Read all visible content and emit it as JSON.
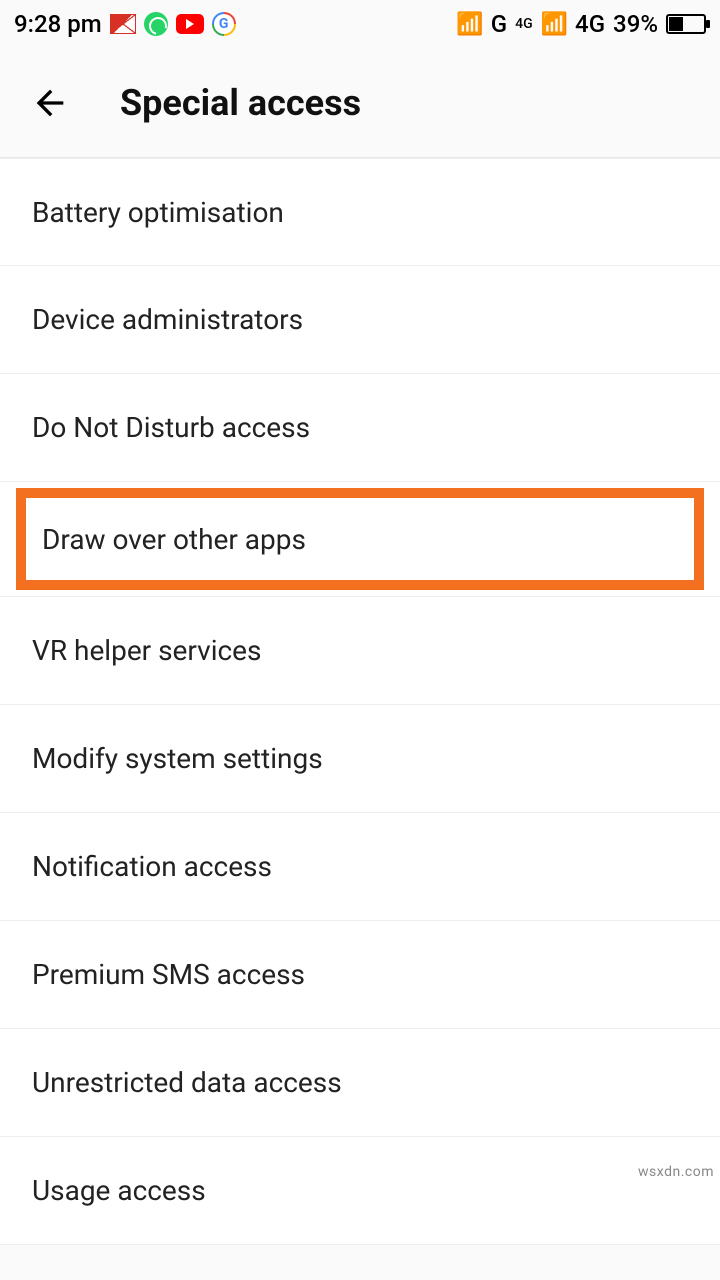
{
  "status": {
    "time": "9:28 pm",
    "icons": {
      "gmail": "gmail-icon",
      "whatsapp": "whatsapp-icon",
      "youtube": "youtube-icon",
      "google": "google-icon"
    },
    "signal1": "📶",
    "net1": "G",
    "net2_small": "4G",
    "signal2": "📶",
    "net2": "4G",
    "battery_pct": "39%",
    "battery_fill_pct": 39
  },
  "header": {
    "title": "Special access"
  },
  "items": [
    {
      "label": "Battery optimisation",
      "highlight": false
    },
    {
      "label": "Device administrators",
      "highlight": false
    },
    {
      "label": "Do Not Disturb access",
      "highlight": false
    },
    {
      "label": "Draw over other apps",
      "highlight": true
    },
    {
      "label": "VR helper services",
      "highlight": false
    },
    {
      "label": "Modify system settings",
      "highlight": false
    },
    {
      "label": "Notification access",
      "highlight": false
    },
    {
      "label": "Premium SMS access",
      "highlight": false
    },
    {
      "label": "Unrestricted data access",
      "highlight": false
    },
    {
      "label": "Usage access",
      "highlight": false
    }
  ],
  "watermark": "wsxdn.com",
  "highlight_color": "#f37021"
}
